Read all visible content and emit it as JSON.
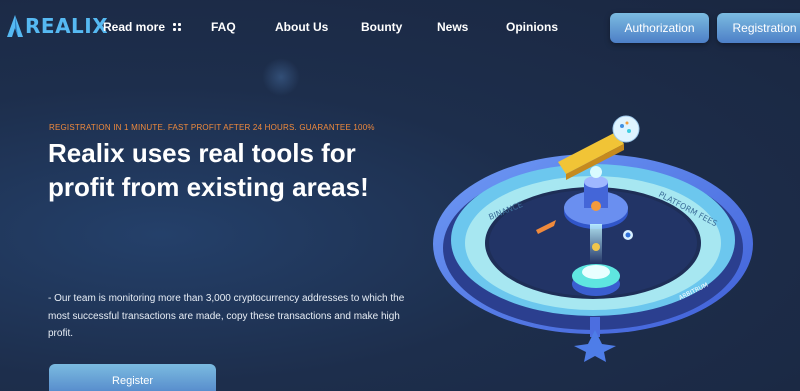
{
  "brand": {
    "name": "REALIX"
  },
  "nav": {
    "read_more": "Read more",
    "items": [
      "FAQ",
      "About Us",
      "Bounty",
      "News",
      "Opinions"
    ]
  },
  "header_buttons": {
    "authorization": "Authorization",
    "registration": "Registration"
  },
  "hero": {
    "tagline": "REGISTRATION IN 1 MINUTE. FAST PROFIT AFTER 24 HOURS. GUARANTEE 100%",
    "headline": "Realix uses real tools for profit from existing areas!",
    "description": "- Our team is monitoring more than 3,000 cryptocurrency addresses to which the most successful transactions are made, copy these transactions and make high profit.",
    "register_button": "Register"
  },
  "illustration": {
    "label_left": "BINANCE",
    "label_right": "PLATFORM FEES",
    "label_bottom": "ARBITRUM"
  },
  "colors": {
    "background": "#1d2e4c",
    "accent_blue": "#56b9f2",
    "accent_orange": "#f08a3c",
    "button_gradient_top": "#7bbbe0",
    "button_gradient_bottom": "#4d7fc7"
  },
  "icons": {
    "logo": "realix-logo-icon",
    "read_more": "grid-dots-icon"
  }
}
